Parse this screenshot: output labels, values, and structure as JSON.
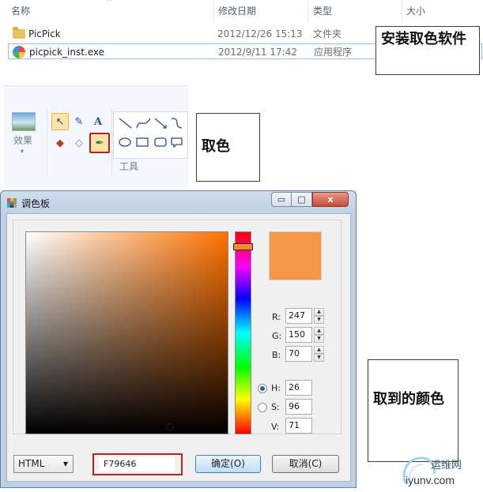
{
  "explorer": {
    "columns": [
      "名称",
      "修改日期",
      "类型",
      "大小"
    ],
    "files": [
      {
        "name": "PicPick",
        "date": "2012/12/26 15:13",
        "type": "文件夹",
        "icon": "folder-icon"
      },
      {
        "name": "picpick_inst.exe",
        "date": "2012/9/11 17:42",
        "type": "应用程序",
        "icon": "picpick-app-icon"
      }
    ]
  },
  "callouts": {
    "install": "安装取色软件",
    "pick": "取色",
    "result": "取到的颜色"
  },
  "ribbon": {
    "effects_label": "效果",
    "tools_label": "工具"
  },
  "dialog": {
    "title": "调色板",
    "current_color": "#F79646",
    "rgb": {
      "r_label": "R:",
      "r": "247",
      "g_label": "G:",
      "g": "150",
      "b_label": "B:",
      "b": "70"
    },
    "hsv": {
      "h_label": "H:",
      "h": "26",
      "s_label": "S:",
      "s": "96",
      "v_label": "V:",
      "v": "71"
    },
    "format": "HTML",
    "hex_value": "F79646",
    "ok_label": "确定(O)",
    "cancel_label": "取消(C)"
  },
  "watermark": {
    "site_cn": "运维网",
    "site_url": "iyunv.com"
  },
  "colors": {
    "hue_base": "#ff7200",
    "highlight": "#b22222"
  }
}
